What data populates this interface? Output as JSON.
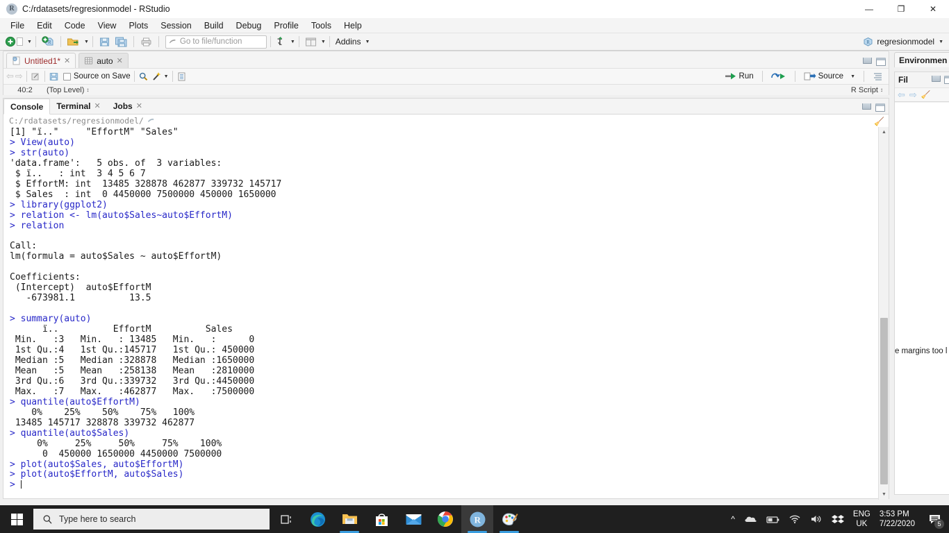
{
  "window": {
    "title": "C:/rdatasets/regresionmodel - RStudio",
    "app_icon": "r-logo-icon",
    "minimize_label": "—",
    "restore_label": "❐",
    "close_label": "✕"
  },
  "menubar": {
    "items": [
      "File",
      "Edit",
      "Code",
      "View",
      "Plots",
      "Session",
      "Build",
      "Debug",
      "Profile",
      "Tools",
      "Help"
    ]
  },
  "toolbar": {
    "new_file_icon": "new-file-icon",
    "new_project_icon": "new-project-icon",
    "open_icon": "open-folder-icon",
    "save_icon": "save-icon",
    "save_all_icon": "save-all-icon",
    "print_icon": "print-icon",
    "goto_placeholder": "Go to file/function",
    "goto_value": "",
    "goto_icon": "goto-arrow-icon",
    "addins_label": "Addins",
    "version_icon": "version-control-icon",
    "panes_icon": "workspace-panes-icon",
    "project_name": "regresionmodel",
    "project_icon": "project-cube-icon"
  },
  "source_pane": {
    "tabs": [
      {
        "label": "Untitled1*",
        "icon": "r-script-icon",
        "closable": true,
        "active": true,
        "dirty": true
      },
      {
        "label": "auto",
        "icon": "data-grid-icon",
        "closable": true,
        "active": false,
        "dirty": false
      }
    ],
    "toolbar": {
      "back_icon": "back-arrow-icon",
      "forward_icon": "forward-arrow-icon",
      "popout_icon": "show-in-new-window-icon",
      "save_icon": "save-icon",
      "source_on_save_label": "Source on Save",
      "source_on_save_checked": false,
      "find_icon": "magnifier-icon",
      "magic_icon": "code-tools-wand-icon",
      "compile_report_icon": "compile-report-icon",
      "run_label": "Run",
      "rerun_icon": "rerun-icon",
      "source_label": "Source",
      "outline_icon": "document-outline-icon"
    },
    "status": {
      "cursor_position": "40:2",
      "scope": "(Top Level)",
      "file_type": "R Script"
    },
    "pane_controls": {
      "minimize": "minimize-pane-icon",
      "maximize": "maximize-pane-icon"
    }
  },
  "console_pane": {
    "tabs": [
      {
        "label": "Console",
        "active": true,
        "closable": false
      },
      {
        "label": "Terminal",
        "active": false,
        "closable": true
      },
      {
        "label": "Jobs",
        "active": false,
        "closable": true
      }
    ],
    "working_directory": "C:/rdatasets/regresionmodel/",
    "directory_icon": "open-in-explorer-icon",
    "clear_icon": "broom-clear-console-icon",
    "scrollbar": {
      "up_icon": "scroll-up-icon",
      "down_icon": "scroll-down-icon"
    },
    "lines": [
      {
        "type": "output",
        "text": "[1] \"ï..\"     \"EffortM\" \"Sales\""
      },
      {
        "type": "input",
        "text": "> View(auto)"
      },
      {
        "type": "input",
        "text": "> str(auto)"
      },
      {
        "type": "output",
        "text": "'data.frame':   5 obs. of  3 variables:"
      },
      {
        "type": "output",
        "text": " $ ï..   : int  3 4 5 6 7"
      },
      {
        "type": "output",
        "text": " $ EffortM: int  13485 328878 462877 339732 145717"
      },
      {
        "type": "output",
        "text": " $ Sales  : int  0 4450000 7500000 450000 1650000"
      },
      {
        "type": "input",
        "text": "> library(ggplot2)"
      },
      {
        "type": "input",
        "text": "> relation <- lm(auto$Sales~auto$EffortM)"
      },
      {
        "type": "input",
        "text": "> relation"
      },
      {
        "type": "output",
        "text": ""
      },
      {
        "type": "output",
        "text": "Call:"
      },
      {
        "type": "output",
        "text": "lm(formula = auto$Sales ~ auto$EffortM)"
      },
      {
        "type": "output",
        "text": ""
      },
      {
        "type": "output",
        "text": "Coefficients:"
      },
      {
        "type": "output",
        "text": " (Intercept)  auto$EffortM"
      },
      {
        "type": "output",
        "text": "   -673981.1          13.5"
      },
      {
        "type": "output",
        "text": ""
      },
      {
        "type": "input",
        "text": "> summary(auto)"
      },
      {
        "type": "output",
        "text": "      ï..          EffortM          Sales"
      },
      {
        "type": "output",
        "text": " Min.   :3   Min.   : 13485   Min.   :      0"
      },
      {
        "type": "output",
        "text": " 1st Qu.:4   1st Qu.:145717   1st Qu.: 450000"
      },
      {
        "type": "output",
        "text": " Median :5   Median :328878   Median :1650000"
      },
      {
        "type": "output",
        "text": " Mean   :5   Mean   :258138   Mean   :2810000"
      },
      {
        "type": "output",
        "text": " 3rd Qu.:6   3rd Qu.:339732   3rd Qu.:4450000"
      },
      {
        "type": "output",
        "text": " Max.   :7   Max.   :462877   Max.   :7500000"
      },
      {
        "type": "input",
        "text": "> quantile(auto$EffortM)"
      },
      {
        "type": "output",
        "text": "    0%    25%    50%    75%   100%"
      },
      {
        "type": "output",
        "text": " 13485 145717 328878 339732 462877"
      },
      {
        "type": "input",
        "text": "> quantile(auto$Sales)"
      },
      {
        "type": "output",
        "text": "     0%     25%     50%     75%    100%"
      },
      {
        "type": "output",
        "text": "      0  450000 1650000 4450000 7500000"
      },
      {
        "type": "input",
        "text": "> plot(auto$Sales, auto$EffortM)"
      },
      {
        "type": "input",
        "text": "> plot(auto$EffortM, auto$Sales)"
      },
      {
        "type": "input",
        "text": "> "
      }
    ]
  },
  "right_panel": {
    "environment_tab": "Environmen",
    "files_tab": "Fil",
    "clipped_message": "e margins too l",
    "back_icon": "back-arrow-icon",
    "forward_icon": "forward-arrow-icon",
    "broom_icon": "broom-clear-icon",
    "pane_controls": {
      "minimize": "minimize-pane-icon",
      "maximize": "maximize-pane-icon"
    }
  },
  "taskbar": {
    "start_label": "windows-start-icon",
    "search_placeholder": "Type here to search",
    "search_value": "",
    "search_icon": "search-icon",
    "apps": [
      {
        "name": "task-view-icon",
        "active": false,
        "running": false
      },
      {
        "name": "microsoft-edge-icon",
        "active": false,
        "running": false
      },
      {
        "name": "file-explorer-icon",
        "active": false,
        "running": true
      },
      {
        "name": "microsoft-store-icon",
        "active": false,
        "running": false
      },
      {
        "name": "mail-icon",
        "active": false,
        "running": false
      },
      {
        "name": "google-chrome-icon",
        "active": false,
        "running": true
      },
      {
        "name": "rstudio-icon",
        "active": true,
        "running": true
      },
      {
        "name": "paint-icon",
        "active": false,
        "running": true
      }
    ],
    "tray": {
      "chevron_icon": "show-hidden-icons-icon",
      "onedrive_icon": "onedrive-icon",
      "battery_icon": "battery-icon",
      "wifi_icon": "wifi-icon",
      "volume_icon": "volume-icon",
      "dropbox_icon": "dropbox-icon",
      "language_line1": "ENG",
      "language_line2": "UK",
      "time": "3:53 PM",
      "date": "7/22/2020",
      "notification_icon": "notifications-icon",
      "notification_count": "5"
    }
  },
  "colors": {
    "console_input": "#2727c8",
    "console_output": "#1a1a1a",
    "accent_blue": "#3a9ee0",
    "taskbar_bg": "#1f1f1f"
  }
}
